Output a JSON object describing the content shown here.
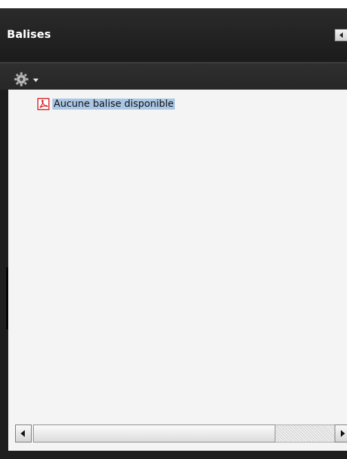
{
  "panel": {
    "title": "Balises",
    "collapse_icon": "chevron-left-icon"
  },
  "toolbar": {
    "options_icon": "gear-icon",
    "options_menu_icon": "dropdown-caret-icon"
  },
  "tree": {
    "items": [
      {
        "icon": "pdf-document-icon",
        "label": "Aucune balise disponible",
        "selected": true
      }
    ]
  },
  "scrollbar": {
    "left_icon": "scroll-left-icon",
    "right_icon": "scroll-right-icon"
  },
  "colors": {
    "panel_bg": "#1e1e1e",
    "content_bg": "#f4f4f4",
    "selection_bg": "#a9c6e4",
    "pdf_red": "#d4262a"
  }
}
